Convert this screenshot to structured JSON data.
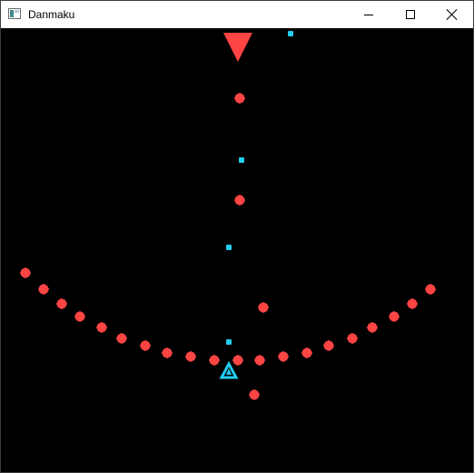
{
  "window": {
    "title": "Danmaku",
    "icon": "app-window-icon",
    "controls": {
      "minimize_icon": "minimize-icon",
      "maximize_icon": "maximize-icon",
      "close_icon": "close-icon"
    }
  },
  "colors": {
    "background": "#000000",
    "enemy": "#ff4444",
    "enemy_bullet": "#ff4444",
    "player": "#22ccee",
    "player_bullet": "#22ccee"
  }
}
